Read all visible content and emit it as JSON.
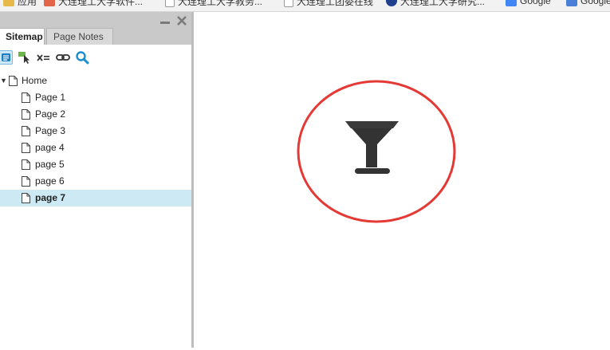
{
  "bookmarks": [
    {
      "label": "应用",
      "icon": "apps-icon"
    },
    {
      "label": "大连理工大学软件...",
      "icon": "bookmark-icon"
    },
    {
      "label": "大连理工大学教务...",
      "icon": "page-icon"
    },
    {
      "label": "大连理工团委在线",
      "icon": "page-icon"
    },
    {
      "label": "大连理工大学研究...",
      "icon": "school-icon"
    },
    {
      "label": "Google",
      "icon": "google-icon"
    },
    {
      "label": "Google",
      "icon": "translate-icon"
    }
  ],
  "sidebar": {
    "tabs": [
      "Sitemap",
      "Page Notes"
    ],
    "active_tab": "Sitemap",
    "toolbar": [
      "pages-icon",
      "cursor-icon",
      "variables-icon",
      "link-icon",
      "search-icon"
    ],
    "tree": {
      "root": "Home",
      "pages": [
        "Page 1",
        "Page 2",
        "Page 3",
        "page 4",
        "page 5",
        "page 6",
        "page 7"
      ],
      "selected": "page 7"
    }
  },
  "canvas": {
    "icon": "cocktail-glass-icon",
    "colors": {
      "circle": "#e53935",
      "icon": "#333333"
    }
  }
}
